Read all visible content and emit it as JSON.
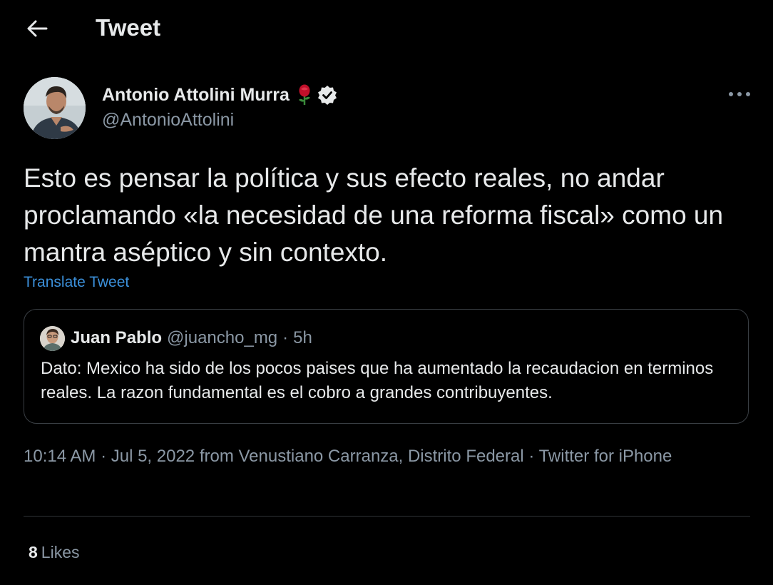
{
  "header": {
    "title": "Tweet",
    "back_icon": "arrow-left-icon"
  },
  "author": {
    "name": "Antonio Attolini Murra",
    "handle": "@AntonioAttolini",
    "badges": [
      "rose-icon",
      "verified-badge-icon"
    ]
  },
  "tweet": {
    "text": "Esto es pensar la política y sus efecto reales, no andar proclamando «la necesidad de una reforma fiscal» como un mantra aséptico y sin contexto.",
    "translate_label": "Translate Tweet",
    "more_icon": "more-horizontal-icon"
  },
  "quote": {
    "name": "Juan Pablo",
    "handle": "@juancho_mg",
    "separator": "·",
    "time": "5h",
    "text": "Dato: Mexico ha sido de los pocos paises que ha aumentado la recaudacion en terminos reales. La razon fundamental es el cobro a grandes contribuyentes."
  },
  "meta": {
    "time": "10:14 AM",
    "sep1": " · ",
    "date": "Jul 5, 2022",
    "location": " from Venustiano Carranza, Distrito Federal",
    "sep2": " · ",
    "source": "Twitter for iPhone"
  },
  "stats": {
    "likes_count": "8",
    "likes_label": "Likes"
  },
  "colors": {
    "background": "#000000",
    "text": "#e7e9ea",
    "secondary_text": "#8b98a5",
    "link": "#3b8fd9",
    "border": "#2f3336",
    "rose": "#c0102a"
  }
}
